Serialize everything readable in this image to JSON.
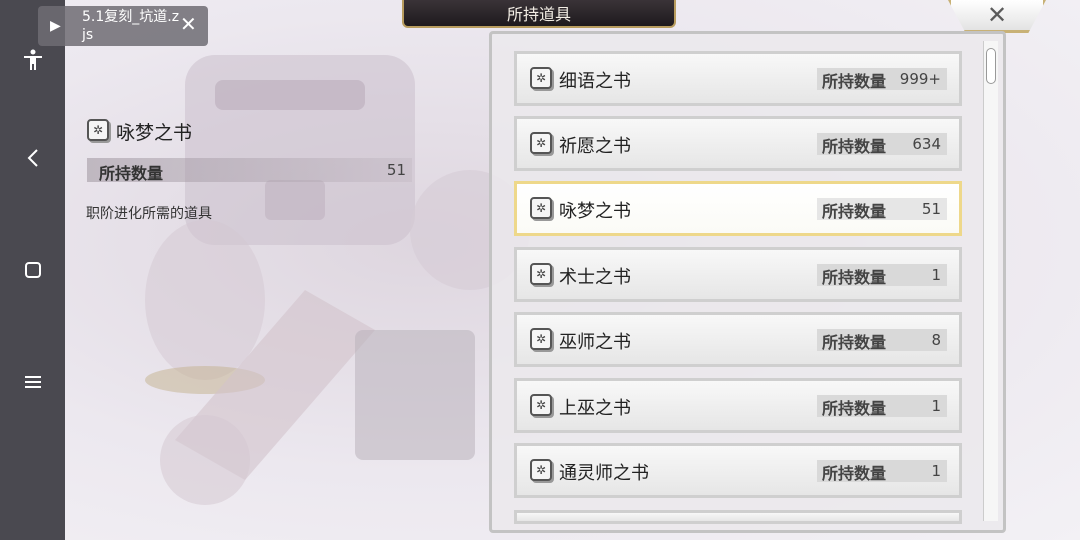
{
  "navbar": {
    "accessibility_icon": "accessibility-icon",
    "back_icon": "back-chevron-icon",
    "home_icon": "home-square-icon",
    "menu_icon": "menu-icon"
  },
  "file_toast": {
    "play_icon": "play-icon",
    "filename": "5.1复刻_坑道.zjs",
    "close_icon": "close-icon"
  },
  "title": "所持道具",
  "close_button_icon": "close-x-icon",
  "detail": {
    "icon": "book-icon",
    "name": "咏梦之书",
    "qty_label": "所持数量",
    "qty_value": "51",
    "description": "职阶进化所需的道具"
  },
  "items": [
    {
      "name": "细语之书",
      "qty_label": "所持数量",
      "qty": "999+",
      "selected": false
    },
    {
      "name": "祈愿之书",
      "qty_label": "所持数量",
      "qty": "634",
      "selected": false
    },
    {
      "name": "咏梦之书",
      "qty_label": "所持数量",
      "qty": "51",
      "selected": true
    },
    {
      "name": "术士之书",
      "qty_label": "所持数量",
      "qty": "1",
      "selected": false
    },
    {
      "name": "巫师之书",
      "qty_label": "所持数量",
      "qty": "8",
      "selected": false
    },
    {
      "name": "上巫之书",
      "qty_label": "所持数量",
      "qty": "1",
      "selected": false
    },
    {
      "name": "通灵师之书",
      "qty_label": "所持数量",
      "qty": "1",
      "selected": false
    }
  ],
  "colors": {
    "selected_border": "#eed88a",
    "banner_gold": "#b89c5e",
    "navbar": "#4a4950"
  }
}
